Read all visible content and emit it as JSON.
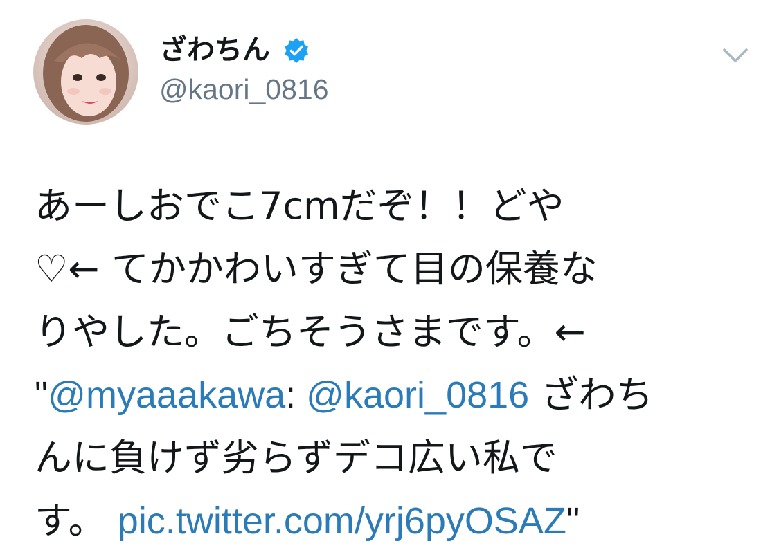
{
  "author": {
    "display_name": "ざわちん",
    "handle": "@kaori_0816",
    "verified": true,
    "avatar": "profile-photo"
  },
  "menu": {
    "icon": "chevron-down-icon"
  },
  "tweet": {
    "line1": {
      "text": "あーしおでこ7cmだぞ！！どや"
    },
    "line2": {
      "text": "♡← てかかわいすぎて目の保養な"
    },
    "line3": {
      "text": "りやした。ごちそうさまです。←"
    },
    "line4": {
      "quote_open": "\"",
      "mention1": "@myaaakawa",
      "colon": ":",
      "space": " ",
      "mention2": "@kaori_0816",
      "text_after": " ざわち"
    },
    "line5": {
      "text": "んに負けず劣らずデコ広い私で"
    },
    "line6": {
      "text_before": "す。",
      "link": "pic.twitter.com/yrj6pyOSAZ",
      "quote_close": "\""
    }
  },
  "colors": {
    "text": "#14171a",
    "secondary": "#657786",
    "link": "#2b7bb9",
    "verified": "#1da1f2"
  }
}
